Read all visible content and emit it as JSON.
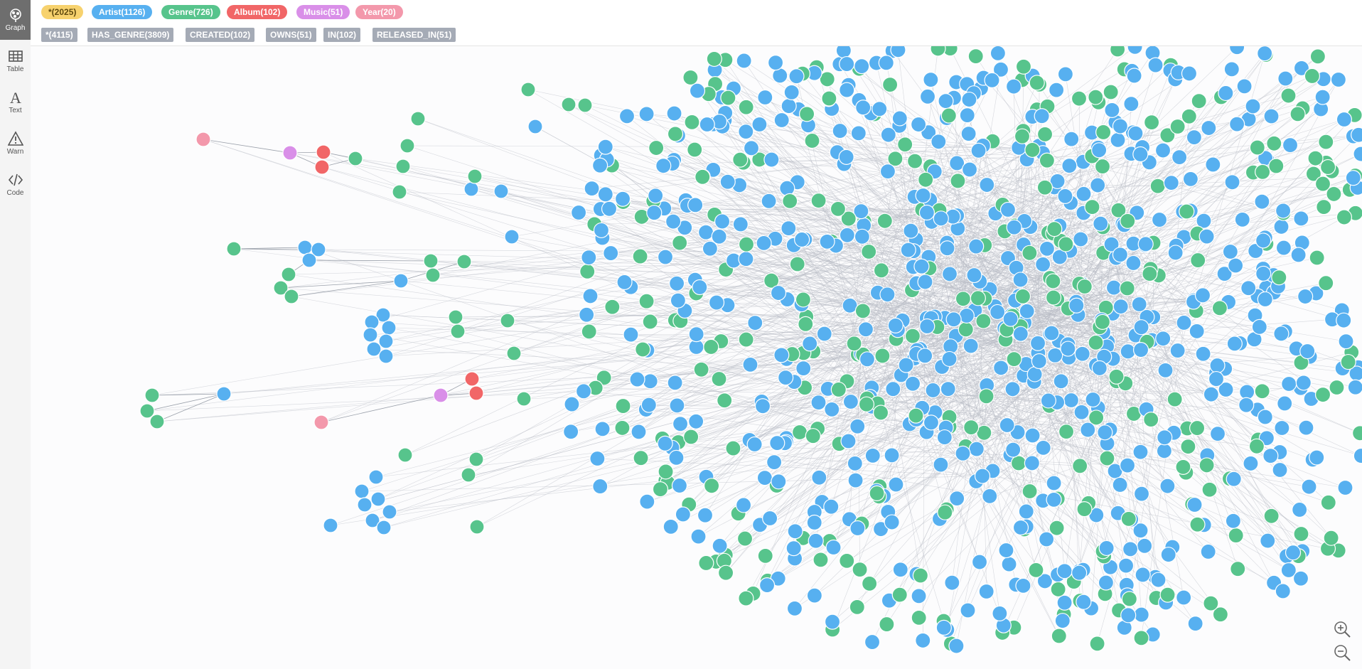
{
  "sidebar": {
    "items": [
      {
        "label": "Graph",
        "icon": "graph-icon",
        "active": true
      },
      {
        "label": "Table",
        "icon": "table-icon",
        "active": false
      },
      {
        "label": "Text",
        "icon": "text-icon",
        "active": false
      },
      {
        "label": "Warn",
        "icon": "warn-icon",
        "active": false
      },
      {
        "label": "Code",
        "icon": "code-icon",
        "active": false
      }
    ]
  },
  "node_labels": [
    {
      "text": "*(2025)",
      "color": "#f7d26e",
      "text_color": "#604a0e"
    },
    {
      "text": "Artist(1126)",
      "color": "#57b0f0"
    },
    {
      "text": "Genre(726)",
      "color": "#57c48c"
    },
    {
      "text": "Album(102)",
      "color": "#f16667"
    },
    {
      "text": "Music(51)",
      "color": "#d98fe8"
    },
    {
      "text": "Year(20)",
      "color": "#f398ab"
    }
  ],
  "relationship_types": [
    {
      "text": "*(4115)"
    },
    {
      "text": "HAS_GENRE(3809)"
    },
    {
      "text": "CREATED(102)"
    },
    {
      "text": "OWNS(51)"
    },
    {
      "text": "IN(102)"
    },
    {
      "text": "RELEASED_IN(51)"
    }
  ],
  "graph": {
    "node_colors": {
      "artist": "#57b0f0",
      "genre": "#57c48c",
      "album": "#f16667",
      "music": "#d98fe8",
      "year": "#f398ab"
    },
    "edge_color": "#b8bcc4"
  },
  "zoom": {
    "in_icon": "zoom-in-icon",
    "out_icon": "zoom-out-icon"
  }
}
